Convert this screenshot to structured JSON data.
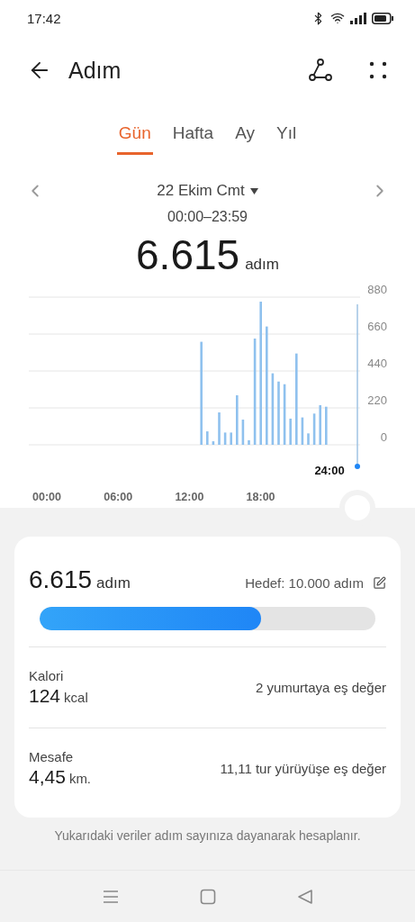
{
  "status_bar": {
    "time": "17:42"
  },
  "header": {
    "title": "Adım"
  },
  "tabs": [
    {
      "label": "Gün",
      "selected": true
    },
    {
      "label": "Hafta",
      "selected": false
    },
    {
      "label": "Ay",
      "selected": false
    },
    {
      "label": "Yıl",
      "selected": false
    }
  ],
  "date": {
    "label": "22 Ekim Cmt",
    "range": "00:00–23:59"
  },
  "total": {
    "value": "6.615",
    "unit": "adım"
  },
  "chart": {
    "cursor_label": "24:00",
    "chart_data": {
      "type": "bar",
      "x": [
        13,
        13.5,
        14,
        14.5,
        15,
        15.5,
        16,
        16.5,
        17,
        17.5,
        18,
        18.5,
        19,
        19.5,
        20,
        20.5,
        21,
        21.5,
        22,
        22.5,
        23,
        23.5
      ],
      "values": [
        614,
        80,
        21,
        193,
        73,
        73,
        295,
        150,
        27,
        633,
        853,
        705,
        426,
        377,
        361,
        156,
        544,
        163,
        68,
        186,
        236,
        227
      ],
      "xlim": [
        0,
        24
      ],
      "ylim": [
        0,
        880
      ],
      "xticks": [
        {
          "value": 0,
          "label": "00:00"
        },
        {
          "value": 6,
          "label": "06:00"
        },
        {
          "value": 12,
          "label": "12:00"
        },
        {
          "value": 18,
          "label": "18:00"
        }
      ],
      "yticks": [
        0,
        220,
        440,
        660,
        880
      ],
      "grid": true
    }
  },
  "summary": {
    "value": "6.615",
    "unit": "adım",
    "goal": "Hedef: 10.000 adım",
    "level": 0.66,
    "metrics": [
      {
        "label": "Kalori",
        "value": "124",
        "unit": "kcal",
        "note": "2 yumurtaya eş değer"
      },
      {
        "label": "Mesafe",
        "value": "4,45",
        "unit": "km.",
        "note": "11,11 tur yürüyüşe eş değer"
      }
    ]
  },
  "footnote": "Yukarıdaki veriler adım sayınıza dayanarak hesaplanır."
}
